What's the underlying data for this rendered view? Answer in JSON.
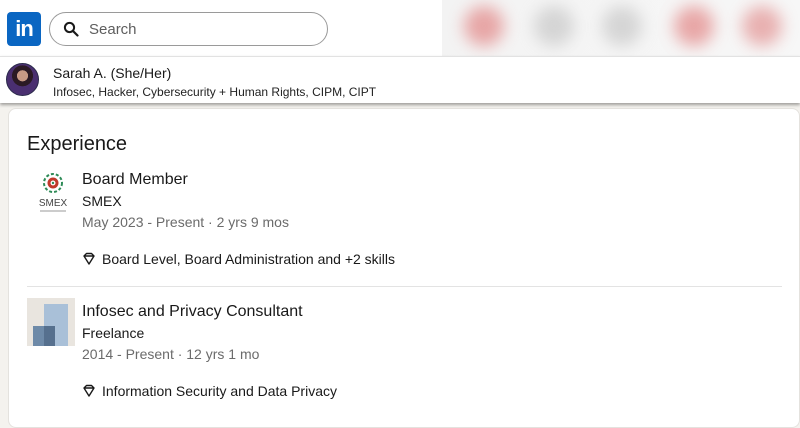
{
  "header": {
    "logo_text": "in",
    "search_placeholder": "Search",
    "brand_color": "#0a66c2"
  },
  "profile": {
    "name": "Sarah A.",
    "pronouns": "(She/Her)",
    "headline": "Infosec, Hacker, Cybersecurity + Human Rights, CIPM, CIPT"
  },
  "experience": {
    "title": "Experience",
    "items": [
      {
        "role": "Board Member",
        "company": "SMEX",
        "dates": "May 2023 - Present · 2 yrs 9 mos",
        "skills": "Board Level, Board Administration and +2 skills",
        "logo_text": "SMEX",
        "logo_icon": "smex-logo"
      },
      {
        "role": "Infosec and Privacy Consultant",
        "company": "Freelance",
        "dates": "2014 - Present · 12 yrs 1 mo",
        "skills": "Information Security and Data Privacy",
        "logo_icon": "freelance-placeholder-logo"
      }
    ]
  }
}
